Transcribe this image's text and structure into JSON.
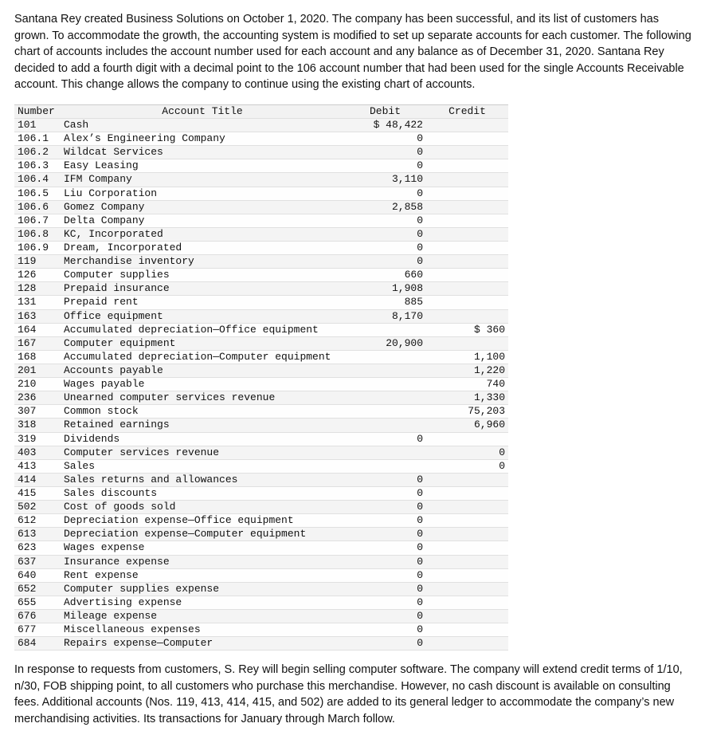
{
  "intro": "Santana Rey created Business Solutions on October 1, 2020. The company has been successful, and its list of customers has grown. To accommodate the growth, the accounting system is modified to set up separate accounts for each customer. The following chart of accounts includes the account number used for each account and any balance as of December 31, 2020. Santana Rey decided to add a fourth digit with a decimal point to the 106 account number that had been used for the single Accounts Receivable account. This change allows the company to continue using the existing chart of accounts.",
  "headers": {
    "number": "Number",
    "title": "Account Title",
    "debit": "Debit",
    "credit": "Credit"
  },
  "accounts": [
    {
      "number": "101",
      "title": "Cash",
      "debit": "$ 48,422",
      "credit": ""
    },
    {
      "number": "106.1",
      "title": "Alex’s Engineering Company",
      "debit": "0",
      "credit": ""
    },
    {
      "number": "106.2",
      "title": "Wildcat Services",
      "debit": "0",
      "credit": ""
    },
    {
      "number": "106.3",
      "title": "Easy Leasing",
      "debit": "0",
      "credit": ""
    },
    {
      "number": "106.4",
      "title": "IFM Company",
      "debit": "3,110",
      "credit": ""
    },
    {
      "number": "106.5",
      "title": "Liu Corporation",
      "debit": "0",
      "credit": ""
    },
    {
      "number": "106.6",
      "title": "Gomez Company",
      "debit": "2,858",
      "credit": ""
    },
    {
      "number": "106.7",
      "title": "Delta Company",
      "debit": "0",
      "credit": ""
    },
    {
      "number": "106.8",
      "title": "KC, Incorporated",
      "debit": "0",
      "credit": ""
    },
    {
      "number": "106.9",
      "title": "Dream, Incorporated",
      "debit": "0",
      "credit": ""
    },
    {
      "number": "119",
      "title": "Merchandise inventory",
      "debit": "0",
      "credit": ""
    },
    {
      "number": "126",
      "title": "Computer supplies",
      "debit": "660",
      "credit": ""
    },
    {
      "number": "128",
      "title": "Prepaid insurance",
      "debit": "1,908",
      "credit": ""
    },
    {
      "number": "131",
      "title": "Prepaid rent",
      "debit": "885",
      "credit": ""
    },
    {
      "number": "163",
      "title": "Office equipment",
      "debit": "8,170",
      "credit": ""
    },
    {
      "number": "164",
      "title": "Accumulated depreciation—Office equipment",
      "debit": "",
      "credit": "$ 360"
    },
    {
      "number": "167",
      "title": "Computer equipment",
      "debit": "20,900",
      "credit": ""
    },
    {
      "number": "168",
      "title": "Accumulated depreciation—Computer equipment",
      "debit": "",
      "credit": "1,100"
    },
    {
      "number": "201",
      "title": "Accounts payable",
      "debit": "",
      "credit": "1,220"
    },
    {
      "number": "210",
      "title": "Wages payable",
      "debit": "",
      "credit": "740"
    },
    {
      "number": "236",
      "title": "Unearned computer services revenue",
      "debit": "",
      "credit": "1,330"
    },
    {
      "number": "307",
      "title": "Common stock",
      "debit": "",
      "credit": "75,203"
    },
    {
      "number": "318",
      "title": "Retained earnings",
      "debit": "",
      "credit": "6,960"
    },
    {
      "number": "319",
      "title": "Dividends",
      "debit": "0",
      "credit": ""
    },
    {
      "number": "403",
      "title": "Computer services revenue",
      "debit": "",
      "credit": "0"
    },
    {
      "number": "413",
      "title": "Sales",
      "debit": "",
      "credit": "0"
    },
    {
      "number": "414",
      "title": "Sales returns and allowances",
      "debit": "0",
      "credit": ""
    },
    {
      "number": "415",
      "title": "Sales discounts",
      "debit": "0",
      "credit": ""
    },
    {
      "number": "502",
      "title": "Cost of goods sold",
      "debit": "0",
      "credit": ""
    },
    {
      "number": "612",
      "title": "Depreciation expense—Office equipment",
      "debit": "0",
      "credit": ""
    },
    {
      "number": "613",
      "title": "Depreciation expense—Computer equipment",
      "debit": "0",
      "credit": ""
    },
    {
      "number": "623",
      "title": "Wages expense",
      "debit": "0",
      "credit": ""
    },
    {
      "number": "637",
      "title": "Insurance expense",
      "debit": "0",
      "credit": ""
    },
    {
      "number": "640",
      "title": "Rent expense",
      "debit": "0",
      "credit": ""
    },
    {
      "number": "652",
      "title": "Computer supplies expense",
      "debit": "0",
      "credit": ""
    },
    {
      "number": "655",
      "title": "Advertising expense",
      "debit": "0",
      "credit": ""
    },
    {
      "number": "676",
      "title": "Mileage expense",
      "debit": "0",
      "credit": ""
    },
    {
      "number": "677",
      "title": "Miscellaneous expenses",
      "debit": "0",
      "credit": ""
    },
    {
      "number": "684",
      "title": "Repairs expense—Computer",
      "debit": "0",
      "credit": ""
    }
  ],
  "outro": "In response to requests from customers, S. Rey will begin selling computer software. The company will extend credit terms of 1/10, n/30, FOB shipping point, to all customers who purchase this merchandise. However, no cash discount is available on consulting fees. Additional accounts (Nos. 119, 413, 414, 415, and 502) are added to its general ledger to accommodate the company’s new merchandising activities. Its transactions for January through March follow.",
  "chart_data": {
    "type": "table",
    "title": "Chart of Accounts — balances as of December 31, 2020",
    "columns": [
      "Number",
      "Account Title",
      "Debit",
      "Credit"
    ],
    "rows": [
      [
        "101",
        "Cash",
        48422,
        null
      ],
      [
        "106.1",
        "Alex’s Engineering Company",
        0,
        null
      ],
      [
        "106.2",
        "Wildcat Services",
        0,
        null
      ],
      [
        "106.3",
        "Easy Leasing",
        0,
        null
      ],
      [
        "106.4",
        "IFM Company",
        3110,
        null
      ],
      [
        "106.5",
        "Liu Corporation",
        0,
        null
      ],
      [
        "106.6",
        "Gomez Company",
        2858,
        null
      ],
      [
        "106.7",
        "Delta Company",
        0,
        null
      ],
      [
        "106.8",
        "KC, Incorporated",
        0,
        null
      ],
      [
        "106.9",
        "Dream, Incorporated",
        0,
        null
      ],
      [
        "119",
        "Merchandise inventory",
        0,
        null
      ],
      [
        "126",
        "Computer supplies",
        660,
        null
      ],
      [
        "128",
        "Prepaid insurance",
        1908,
        null
      ],
      [
        "131",
        "Prepaid rent",
        885,
        null
      ],
      [
        "163",
        "Office equipment",
        8170,
        null
      ],
      [
        "164",
        "Accumulated depreciation—Office equipment",
        null,
        360
      ],
      [
        "167",
        "Computer equipment",
        20900,
        null
      ],
      [
        "168",
        "Accumulated depreciation—Computer equipment",
        null,
        1100
      ],
      [
        "201",
        "Accounts payable",
        null,
        1220
      ],
      [
        "210",
        "Wages payable",
        null,
        740
      ],
      [
        "236",
        "Unearned computer services revenue",
        null,
        1330
      ],
      [
        "307",
        "Common stock",
        null,
        75203
      ],
      [
        "318",
        "Retained earnings",
        null,
        6960
      ],
      [
        "319",
        "Dividends",
        0,
        null
      ],
      [
        "403",
        "Computer services revenue",
        null,
        0
      ],
      [
        "413",
        "Sales",
        null,
        0
      ],
      [
        "414",
        "Sales returns and allowances",
        0,
        null
      ],
      [
        "415",
        "Sales discounts",
        0,
        null
      ],
      [
        "502",
        "Cost of goods sold",
        0,
        null
      ],
      [
        "612",
        "Depreciation expense—Office equipment",
        0,
        null
      ],
      [
        "613",
        "Depreciation expense—Computer equipment",
        0,
        null
      ],
      [
        "623",
        "Wages expense",
        0,
        null
      ],
      [
        "637",
        "Insurance expense",
        0,
        null
      ],
      [
        "640",
        "Rent expense",
        0,
        null
      ],
      [
        "652",
        "Computer supplies expense",
        0,
        null
      ],
      [
        "655",
        "Advertising expense",
        0,
        null
      ],
      [
        "676",
        "Mileage expense",
        0,
        null
      ],
      [
        "677",
        "Miscellaneous expenses",
        0,
        null
      ],
      [
        "684",
        "Repairs expense—Computer",
        0,
        null
      ]
    ]
  }
}
